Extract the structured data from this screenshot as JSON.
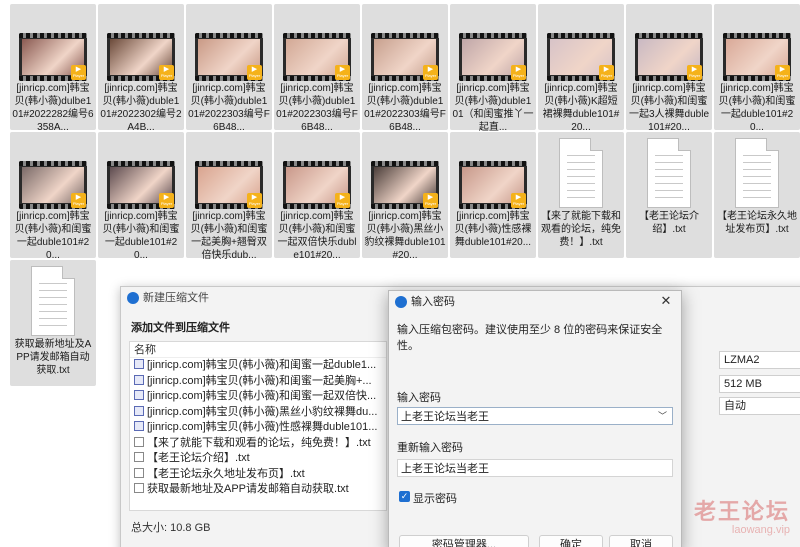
{
  "files": [
    {
      "label": "[jinricp.com]韩宝贝(韩小薇)dulbe101#2022282编号6358A...",
      "type": "video",
      "scene": "#8a5a52"
    },
    {
      "label": "[jinricp.com]韩宝贝(韩小薇)duble101#2022302编号2A4B...",
      "type": "video",
      "scene": "#6b4a3a"
    },
    {
      "label": "[jinricp.com]韩宝贝(韩小薇)duble101#2022303编号F6B48...",
      "type": "video",
      "scene": "#c99a86"
    },
    {
      "label": "[jinricp.com]韩宝贝(韩小薇)duble101#2022303编号F6B48...",
      "type": "video",
      "scene": "#d2a895"
    },
    {
      "label": "[jinricp.com]韩宝贝(韩小薇)duble101#2022303编号F6B48...",
      "type": "video",
      "scene": "#c7a08e"
    },
    {
      "label": "[jinricp.com]韩宝贝(韩小薇)duble101（和闺蜜推丫一起直...",
      "type": "video",
      "scene": "#bfa6a8"
    },
    {
      "label": "[jinricp.com]韩宝贝(韩小薇)K超短裙裸舞duble101#20...",
      "type": "video",
      "scene": "#d7c3c8"
    },
    {
      "label": "[jinricp.com]韩宝贝(韩小薇)和闺蜜一起3人裸舞duble101#20...",
      "type": "video",
      "scene": "#c9b9c3"
    },
    {
      "label": "[jinricp.com]韩宝贝(韩小薇)和闺蜜一起duble101#20...",
      "type": "video",
      "scene": "#d9a998"
    },
    {
      "label": "[jinricp.com]韩宝贝(韩小薇)和闺蜜一起duble101#20...",
      "type": "video",
      "scene": "#7a6a68"
    },
    {
      "label": "[jinricp.com]韩宝贝(韩小薇)和闺蜜一起duble101#20...",
      "type": "video",
      "scene": "#5d4b4f"
    },
    {
      "label": "[jinricp.com]韩宝贝(韩小薇)和闺蜜一起美胸+翘臀双倍快乐dub...",
      "type": "video",
      "scene": "#d9a48f"
    },
    {
      "label": "[jinricp.com]韩宝贝(韩小薇)和闺蜜一起双倍快乐duble101#20...",
      "type": "video",
      "scene": "#c9988a"
    },
    {
      "label": "[jinricp.com]韩宝贝(韩小薇)黑丝小豹纹裸舞duble101#20...",
      "type": "video",
      "scene": "#4b3e3a"
    },
    {
      "label": "[jinricp.com]韩宝贝(韩小薇)性感裸舞duble101#20...",
      "type": "video",
      "scene": "#c7988a"
    },
    {
      "label": "【来了就能下载和观看的论坛，纯免费！】.txt",
      "type": "txt"
    },
    {
      "label": "【老王论坛介绍】.txt",
      "type": "txt"
    },
    {
      "label": "【老王论坛永久地址发布页】.txt",
      "type": "txt"
    },
    {
      "label": "获取最新地址及APP请发邮箱自动获取.txt",
      "type": "txt"
    }
  ],
  "thumb_badge": {
    "symbol": "▶",
    "text": "Player"
  },
  "archive_window": {
    "title": "新建压缩文件",
    "subtitle": "添加文件到压缩文件",
    "list_header": "名称",
    "list_items": [
      {
        "name": "[jinricp.com]韩宝贝(韩小薇)和闺蜜一起duble1...",
        "type": "video"
      },
      {
        "name": "[jinricp.com]韩宝贝(韩小薇)和闺蜜一起美胸+...",
        "type": "video"
      },
      {
        "name": "[jinricp.com]韩宝贝(韩小薇)和闺蜜一起双倍快...",
        "type": "video"
      },
      {
        "name": "[jinricp.com]韩宝贝(韩小薇)黑丝小豹纹裸舞du...",
        "type": "video"
      },
      {
        "name": "[jinricp.com]韩宝贝(韩小薇)性感裸舞duble101...",
        "type": "video"
      },
      {
        "name": "【来了就能下载和观看的论坛，纯免费！】.txt",
        "type": "txt"
      },
      {
        "name": "【老王论坛介绍】.txt",
        "type": "txt"
      },
      {
        "name": "【老王论坛永久地址发布页】.txt",
        "type": "txt"
      },
      {
        "name": "获取最新地址及APP请发邮箱自动获取.txt",
        "type": "txt"
      }
    ],
    "total_size": "总大小: 10.8 GB",
    "options": [
      "LZMA2",
      "512 MB",
      "自动"
    ]
  },
  "password_dialog": {
    "title": "输入密码",
    "close_symbol": "✕",
    "hint": "输入压缩包密码。建议使用至少 8 位的密码来保证安全性。",
    "password_label": "输入密码",
    "password_value": "上老王论坛当老王",
    "confirm_label": "重新输入密码",
    "confirm_value": "上老王论坛当老王",
    "show_password_label": "显示密码",
    "show_password_checked": true,
    "check_symbol": "✓",
    "manager_button": "密码管理器...",
    "ok_button": "确定",
    "cancel_button": "取消"
  },
  "watermark": {
    "name": "老王论坛",
    "site": "laowang.vip"
  },
  "colors": {
    "accent": "#1e6fd1",
    "tile_bg": "#dedede",
    "badge": "#f5b21a"
  }
}
